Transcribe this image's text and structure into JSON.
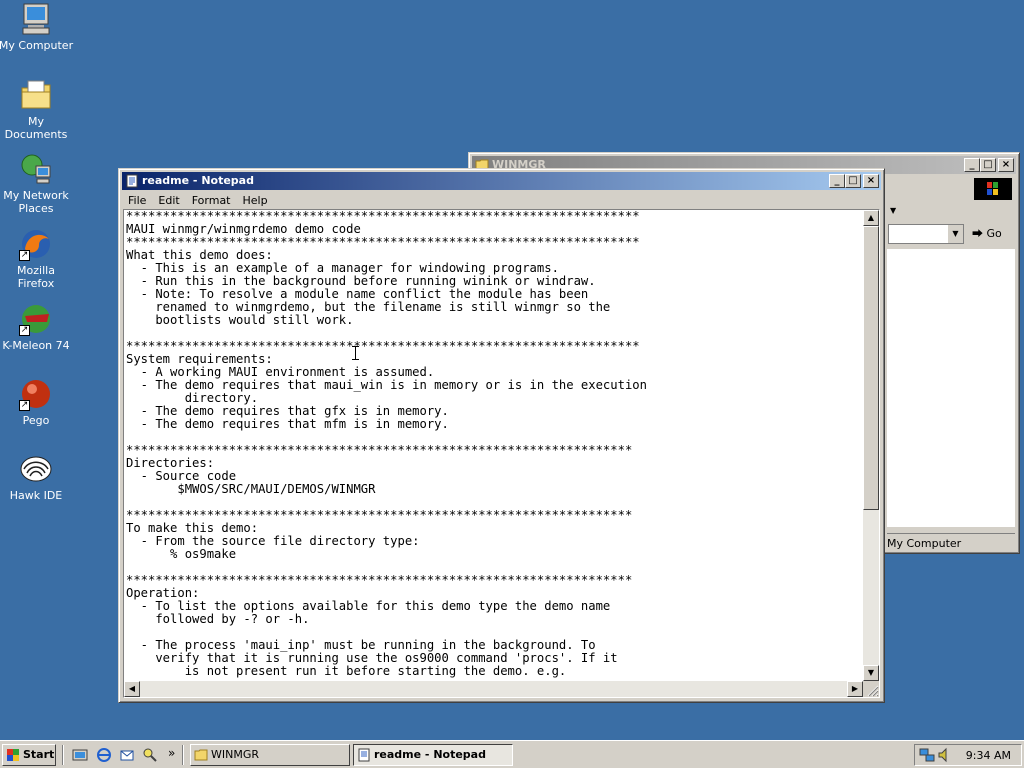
{
  "desktop": {
    "icons": [
      {
        "label": "My Computer",
        "icon": "computer-icon"
      },
      {
        "label": "My Documents",
        "icon": "folder-documents-icon"
      },
      {
        "label": "My Network Places",
        "icon": "network-icon"
      },
      {
        "label": "Mozilla Firefox",
        "icon": "firefox-icon"
      },
      {
        "label": "K-Meleon 74",
        "icon": "kmeleon-icon"
      },
      {
        "label": "Pego",
        "icon": "pego-icon"
      },
      {
        "label": "Hawk IDE",
        "icon": "hawk-icon"
      }
    ]
  },
  "explorer": {
    "title": "WINMGR",
    "go_label": "Go",
    "status": "My Computer"
  },
  "notepad": {
    "title": "readme - Notepad",
    "menu": [
      "File",
      "Edit",
      "Format",
      "Help"
    ],
    "content": "**********************************************************************\nMAUI winmgr/winmgrdemo demo code\n**********************************************************************\nWhat this demo does:\n  - This is an example of a manager for windowing programs.\n  - Run this in the background before running winink or windraw.\n  - Note: To resolve a module name conflict the module has been\n    renamed to winmgrdemo, but the filename is still winmgr so the\n    bootlists would still work.\n\n**********************************************************************\nSystem requirements:\n  - A working MAUI environment is assumed.\n  - The demo requires that maui_win is in memory or is in the execution\n        directory.\n  - The demo requires that gfx is in memory.\n  - The demo requires that mfm is in memory.\n\n*********************************************************************\nDirectories:\n  - Source code\n       $MWOS/SRC/MAUI/DEMOS/WINMGR\n\n*********************************************************************\nTo make this demo:\n  - From the source file directory type:\n      % os9make\n\n*********************************************************************\nOperation:\n  - To list the options available for this demo type the demo name\n    followed by -? or -h.\n\n  - The process 'maui_inp' must be running in the background. To\n    verify that it is running use the os9000 command 'procs'. If it\n        is not present run it before starting the demo. e.g."
  },
  "taskbar": {
    "start_label": "Start",
    "tasks": [
      {
        "label": "WINMGR",
        "active": false
      },
      {
        "label": "readme - Notepad",
        "active": true
      }
    ],
    "chevron": "»",
    "clock": "9:34 AM"
  }
}
